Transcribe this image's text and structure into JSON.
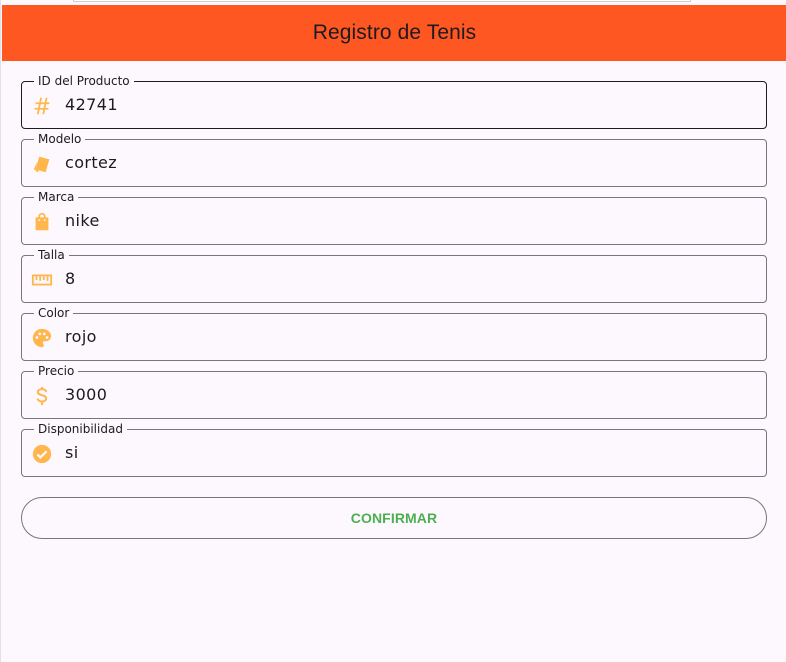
{
  "appbar": {
    "title": "Registro de Tenis",
    "color": "#ff5722"
  },
  "form": {
    "fields": [
      {
        "label": "ID del Producto",
        "value": "42741",
        "icon": "hash-icon"
      },
      {
        "label": "Modelo",
        "value": "cortez",
        "icon": "shoe-icon"
      },
      {
        "label": "Marca",
        "value": "nike",
        "icon": "shopping-bag-icon"
      },
      {
        "label": "Talla",
        "value": "8",
        "icon": "ruler-icon"
      },
      {
        "label": "Color",
        "value": "rojo",
        "icon": "palette-icon"
      },
      {
        "label": "Precio",
        "value": "3000",
        "icon": "dollar-icon"
      },
      {
        "label": "Disponibilidad",
        "value": "si",
        "icon": "check-circle-icon"
      }
    ],
    "icon_color": "#ffb74d",
    "confirm_label": "CONFIRMAR",
    "confirm_color": "#4caf50"
  }
}
